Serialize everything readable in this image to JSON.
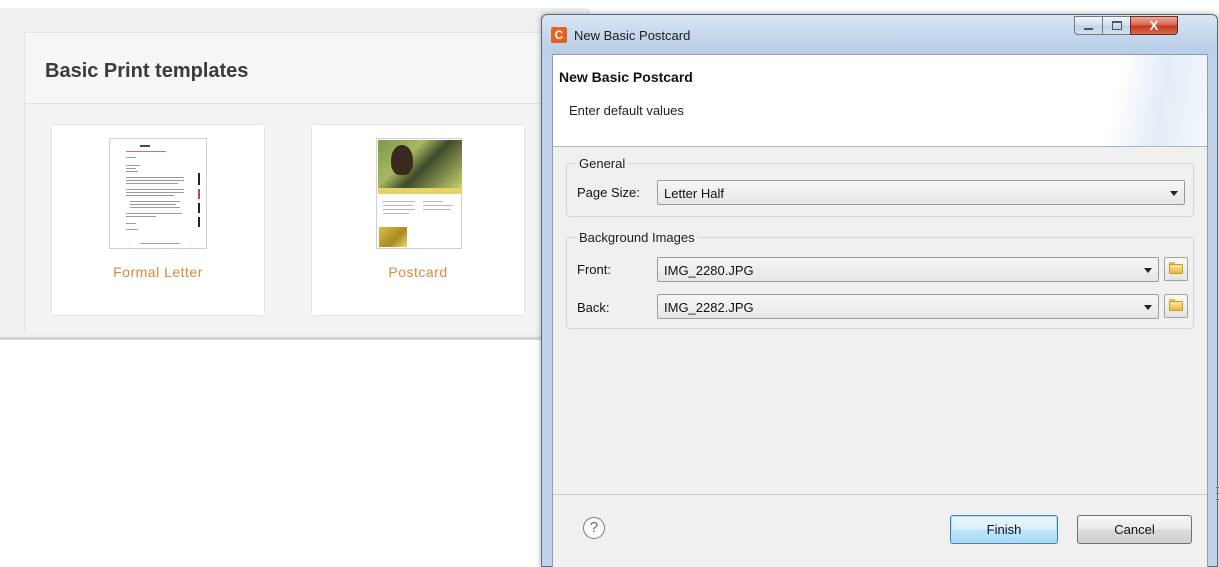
{
  "background": {
    "section_title": "Basic Print templates",
    "templates": [
      {
        "label": "Formal Letter"
      },
      {
        "label": "Postcard"
      }
    ]
  },
  "dialog": {
    "app_icon_letter": "C",
    "window_title": "New Basic Postcard",
    "header_title": "New Basic Postcard",
    "header_subtitle": "Enter default values",
    "general": {
      "group_label": "General",
      "page_size_label": "Page Size:",
      "page_size_value": "Letter Half"
    },
    "background_images": {
      "group_label": "Background Images",
      "front_label": "Front:",
      "front_value": "IMG_2280.JPG",
      "back_label": "Back:",
      "back_value": "IMG_2282.JPG"
    },
    "help_glyph": "?",
    "finish_label": "Finish",
    "cancel_label": "Cancel",
    "close_glyph": "X",
    "colors": {
      "template_label": "#d58a3a",
      "app_icon": "#e8611a",
      "close_button": "#c2381e"
    }
  }
}
